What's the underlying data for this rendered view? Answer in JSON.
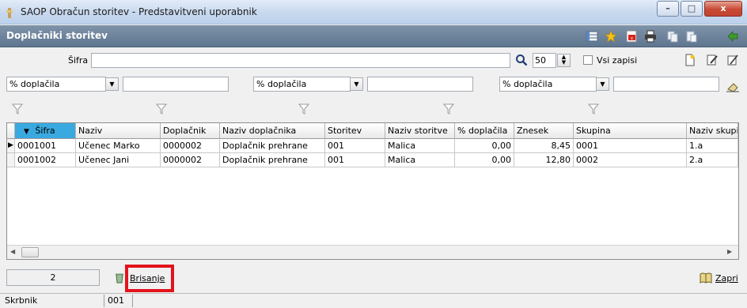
{
  "window": {
    "title": "SAOP Obračun storitev - Predstavitveni uporabnik",
    "buttons": [
      "–",
      "□",
      "x"
    ]
  },
  "panel": {
    "title": "Doplačniki storitev"
  },
  "search": {
    "label": "Šifra",
    "value": "",
    "limit": "50",
    "all_records_label": "Vsi zapisi"
  },
  "filters": [
    {
      "field": "% doplačila",
      "value": ""
    },
    {
      "field": "% doplačila",
      "value": ""
    },
    {
      "field": "% doplačila",
      "value": ""
    }
  ],
  "grid": {
    "sort_indicator": "▼",
    "columns": [
      "Šifra",
      "Naziv",
      "Doplačnik",
      "Naziv doplačnika",
      "Storitev",
      "Naziv storitve",
      "% doplačila",
      "Znesek",
      "Skupina",
      "Naziv skupir"
    ],
    "rows": [
      [
        "0001001",
        "Učenec Marko",
        "0000002",
        "Doplačnik prehrane",
        "001",
        "Malica",
        "0,00",
        "8,45",
        "0001",
        "1.a"
      ],
      [
        "0001002",
        "Učenec Jani",
        "0000002",
        "Doplačnik prehrane",
        "001",
        "Malica",
        "0,00",
        "12,80",
        "0002",
        "2.a"
      ]
    ],
    "current_row_marker": "▶"
  },
  "footer": {
    "record_count": "2",
    "delete_label": "Brisanje",
    "close_label": "Zapri"
  },
  "statusbar": {
    "label": "Skrbnik",
    "value": "001"
  },
  "colors": {
    "highlight": "#e2141b",
    "sorted_header": "#3aa9e0",
    "panel_header": "#6d8299"
  }
}
